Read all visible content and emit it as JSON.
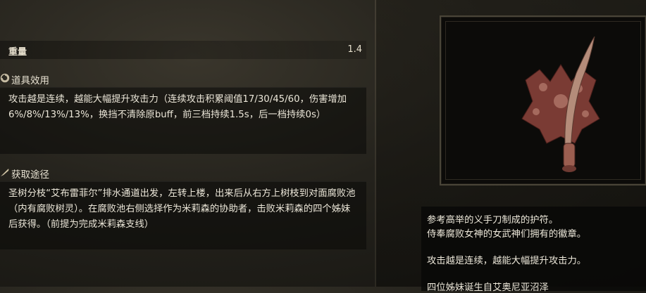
{
  "item": {
    "weight_label": "重量",
    "weight_value": "1.4"
  },
  "effect": {
    "icon": "swirl-icon",
    "title": "道具效用",
    "text": "攻击越是连续，越能大幅提升攻击力（连续攻击积累阈值17/30/45/60，伤害增加6%/8%/13%/13%，换挡不清除原buff，前三档持续1.5s，后一档持续0s）"
  },
  "acquisition": {
    "icon": "feather-icon",
    "title": "获取途径",
    "text": "圣树分枝“艾布雷菲尔”排水通道出发，左转上楼，出来后从右方上树枝到对面腐败池（内有腐败树灵）。在腐败池右侧选择作为米莉森的协助者，击败米莉森的四个姊妹后获得。（前提为完成米莉森支线）"
  },
  "description": {
    "line1": "参考高举的义手刀制成的护符。",
    "line2": "侍奉腐败女神的女武神们拥有的徽章。",
    "line3": "攻击越是连续，越能大幅提升攻击力。",
    "line4": "四位姊妹诞生自艾奥尼亚沼泽"
  }
}
